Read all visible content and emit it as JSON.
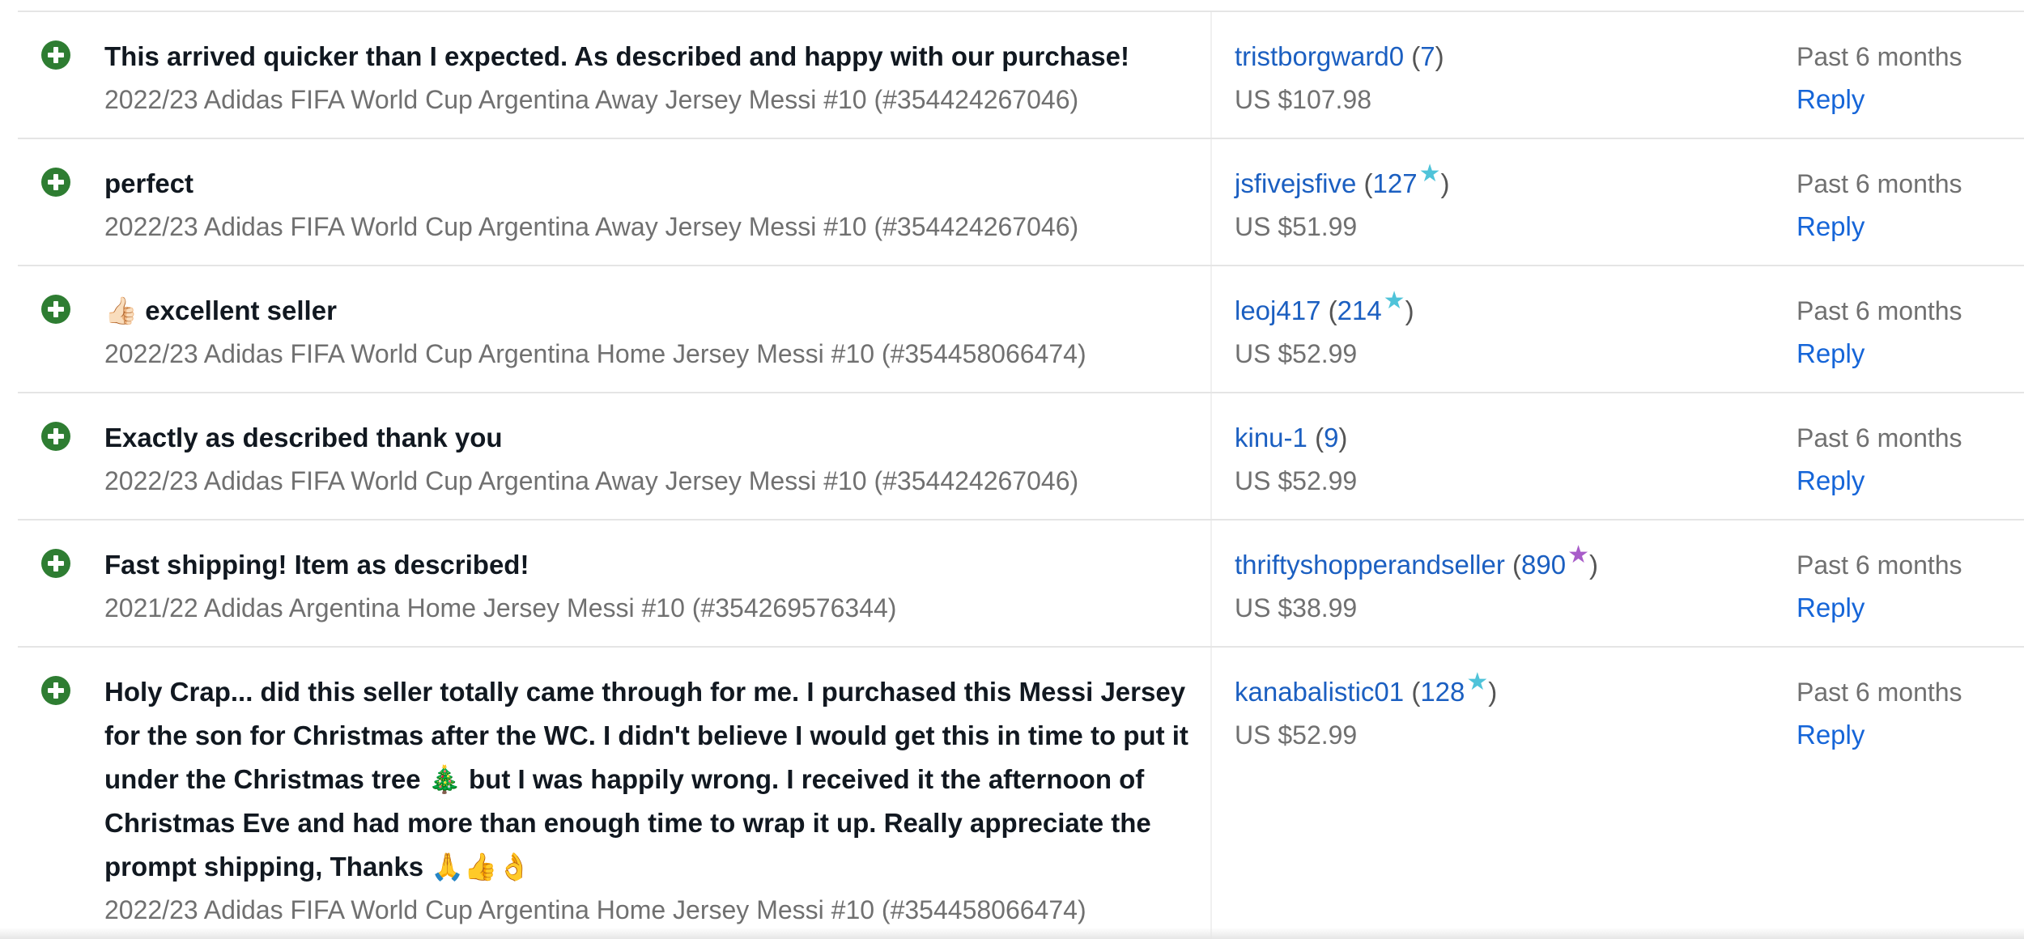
{
  "colors": {
    "positive_icon": "#2e7d32",
    "link": "#1b5fc1",
    "reply": "#1565d8",
    "muted_text": "#707070",
    "divider": "#e5e5e5",
    "star_teal": "#4fc3d9",
    "star_purple": "#a85cc9"
  },
  "feedback": [
    {
      "rating_icon": "plus-circle-icon",
      "comment": "This arrived quicker than I expected. As described and happy with our purchase!",
      "item": "2022/23 Adidas FIFA World Cup Argentina Away Jersey Messi #10 (#354424267046)",
      "user": "tristborgward0",
      "score": "7",
      "star": "",
      "price": "US $107.98",
      "time": "Past 6 months",
      "reply": "Reply"
    },
    {
      "rating_icon": "plus-circle-icon",
      "comment": "perfect",
      "item": "2022/23 Adidas FIFA World Cup Argentina Away Jersey Messi #10 (#354424267046)",
      "user": "jsfivejsfive",
      "score": "127",
      "star": "teal",
      "price": "US $51.99",
      "time": "Past 6 months",
      "reply": "Reply"
    },
    {
      "rating_icon": "plus-circle-icon",
      "comment": "👍🏻 excellent seller",
      "item": "2022/23 Adidas FIFA World Cup Argentina Home Jersey Messi #10 (#354458066474)",
      "user": "leoj417",
      "score": "214",
      "star": "teal",
      "price": "US $52.99",
      "time": "Past 6 months",
      "reply": "Reply"
    },
    {
      "rating_icon": "plus-circle-icon",
      "comment": "Exactly as described thank you",
      "item": "2022/23 Adidas FIFA World Cup Argentina Away Jersey Messi #10 (#354424267046)",
      "user": "kinu-1",
      "score": "9",
      "star": "",
      "price": "US $52.99",
      "time": "Past 6 months",
      "reply": "Reply"
    },
    {
      "rating_icon": "plus-circle-icon",
      "comment": "Fast shipping! Item as described!",
      "item": "2021/22 Adidas Argentina Home Jersey Messi #10 (#354269576344)",
      "user": "thriftyshopperandseller",
      "score": "890",
      "star": "purple",
      "price": "US $38.99",
      "time": "Past 6 months",
      "reply": "Reply"
    },
    {
      "rating_icon": "plus-circle-icon",
      "comment": "Holy Crap... did this seller totally came through for me. I purchased this Messi Jersey\nfor the son for Christmas after the WC. I didn't believe I would get this in time to put it\nunder the Christmas tree 🎄 but I was happily wrong. I received it the afternoon of\nChristmas Eve and had more than enough time to wrap it up. Really appreciate the\nprompt shipping, Thanks 🙏👍👌",
      "item": "2022/23 Adidas FIFA World Cup Argentina Home Jersey Messi #10 (#354458066474)",
      "user": "kanabalistic01",
      "score": "128",
      "star": "teal",
      "price": "US $52.99",
      "time": "Past 6 months",
      "reply": "Reply"
    }
  ]
}
